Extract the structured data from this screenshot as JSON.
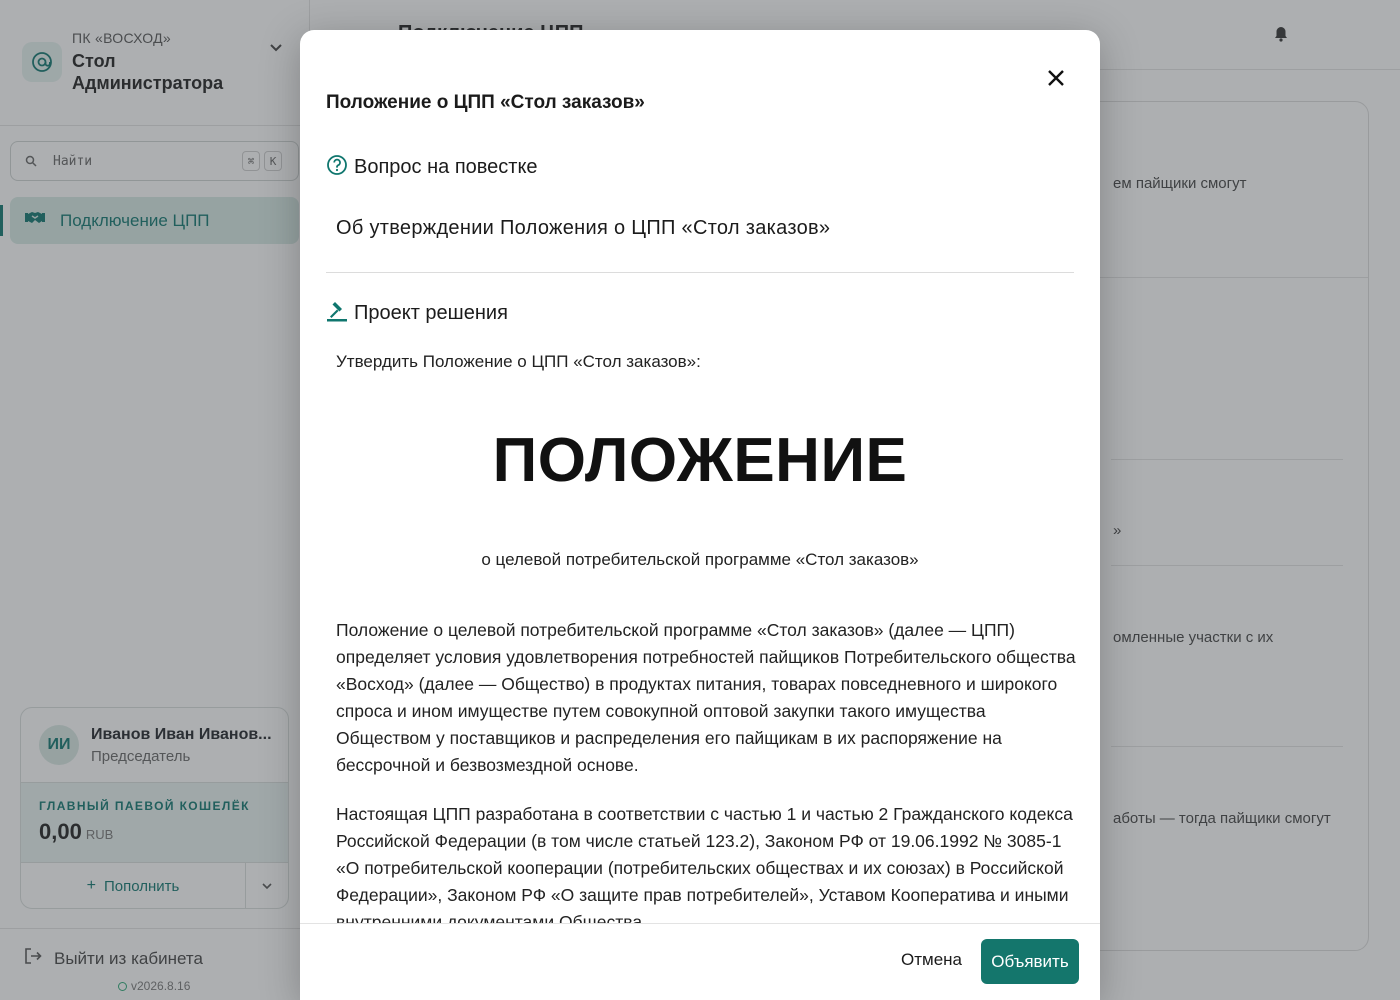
{
  "sidebar": {
    "org_subtitle": "ПК «ВОСХОД»",
    "org_title": "Стол Администратора",
    "search_placeholder": "Найти",
    "shortcut_keys": [
      "⌘",
      "K"
    ],
    "nav_items": [
      {
        "label": "Подключение ЦПП",
        "icon": "handshake-icon",
        "active": true
      }
    ],
    "user": {
      "initials": "ИИ",
      "name": "Иванов Иван Иванов...",
      "role": "Председатель"
    },
    "wallet": {
      "title": "ГЛАВНЫЙ ПАЕВОЙ КОШЕЛЁК",
      "amount": "0,00",
      "currency": "RUB",
      "topup_label": "Пополнить"
    },
    "logout_label": "Выйти из кабинета",
    "version": "v2026.8.16"
  },
  "main": {
    "title": "Подключение ЦПП",
    "background_snippets": [
      "ем пайщики смогут",
      "»",
      "омленные участки с их",
      "аботы — тогда пайщики смогут"
    ]
  },
  "dialog": {
    "title": "Положение о ЦПП «Стол заказов»",
    "agenda_label": "Вопрос на повестке",
    "agenda_text": "Об утверждении Положения о ЦПП «Стол заказов»",
    "decision_label": "Проект решения",
    "decision_intro": "Утвердить Положение о ЦПП «Стол заказов»:",
    "document_heading": "ПОЛОЖЕНИЕ",
    "document_subtitle": "о целевой потребительской программе «Стол заказов»",
    "paragraphs": [
      "Положение о целевой потребительской программе «Стол заказов» (далее — ЦПП) определяет условия удовлетворения потребностей пайщиков Потребительского общества «Восход» (далее — Общество) в продуктах питания, товарах повседневного и широкого спроса и ином имуществе путем совокупной оптовой закупки такого имущества Обществом у поставщиков и распределения его пайщикам в их распоряжение на бессрочной и безвозмездной основе.",
      "Настоящая ЦПП разработана в соответствии с частью 1 и частью 2 Гражданского кодекса Российской Федерации (в том числе статьей 123.2), Законом РФ от 19.06.1992 № 3085-1 «О потребительской кооперации (потребительских обществах и их союзах) в Российской Федерации», Законом РФ «О защите прав потребителей», Уставом Кооператива и иными внутренними документами Общества."
    ],
    "cancel_label": "Отмена",
    "confirm_label": "Объявить"
  },
  "colors": {
    "accent": "#0f766e",
    "accent_bg": "#d7ebe6",
    "primary_button": "#14766c",
    "overlay": "rgba(60,64,70,0.42)"
  }
}
